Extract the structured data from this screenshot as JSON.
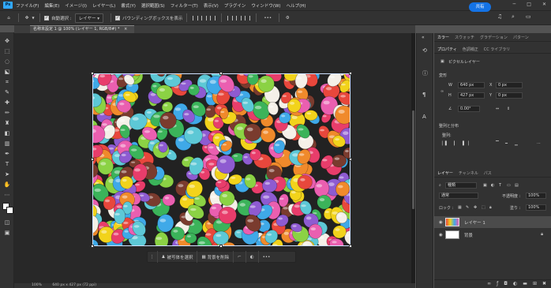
{
  "app": {
    "logo": "Ps"
  },
  "menu": [
    "ファイル(F)",
    "編集(E)",
    "イメージ(I)",
    "レイヤー(L)",
    "書式(Y)",
    "選択範囲(S)",
    "フィルター(T)",
    "表示(V)",
    "プラグイン",
    "ウィンドウ(W)",
    "ヘルプ(H)"
  ],
  "options": {
    "auto_select_label": "自動選択 :",
    "auto_select_value": "レイヤー",
    "bounding_box_label": "バウンディングボックスを表示",
    "more": "•••",
    "share_label": "共有"
  },
  "document": {
    "tab_title": "名称未設定 1 @ 100% (レイヤー 1, RGB/8#) *"
  },
  "context_bar": {
    "select_subject": "被写体を選択",
    "remove_bg": "背景を削除",
    "more": "•••"
  },
  "status": {
    "zoom": "100%",
    "size": "640 px x 427 px (72 ppi)"
  },
  "right_panel": {
    "top_tabs": [
      "カラー",
      "スウォッチ",
      "グラデーション",
      "パターン"
    ],
    "prop_tabs": [
      "プロパティ",
      "色調補正",
      "CC ライブラリ"
    ],
    "pixel_layer": "ピクセルレイヤー",
    "transform_title": "変形",
    "w_label": "W",
    "w_value": "640 px",
    "x_label": "X",
    "x_value": "0 px",
    "h_label": "H",
    "h_value": "427 px",
    "y_label": "Y",
    "y_value": "0 px",
    "angle_value": "0.00°",
    "align_title": "整列と分布",
    "align_label": "整列:"
  },
  "layers_panel": {
    "tabs": [
      "レイヤー",
      "チャンネル",
      "パス"
    ],
    "kind_label": "種類",
    "blend_mode": "通常",
    "opacity_label": "不透明度 :",
    "opacity_value": "100%",
    "lock_label": "ロック :",
    "fill_label": "塗り :",
    "fill_value": "100%",
    "layers": [
      {
        "name": "レイヤー 1"
      },
      {
        "name": "背景"
      }
    ]
  },
  "colors": {
    "accent": "#1473e6",
    "panel": "#323232",
    "workspace": "#282828"
  },
  "candy_colors": [
    "#e8473c",
    "#f2d31b",
    "#3fa9e8",
    "#8bd244",
    "#ea5fb0",
    "#f08a2b",
    "#8e5bd1",
    "#5dc8d6",
    "#e83d6b",
    "#f5f0e8",
    "#7a3b2e",
    "#3bb35a"
  ]
}
